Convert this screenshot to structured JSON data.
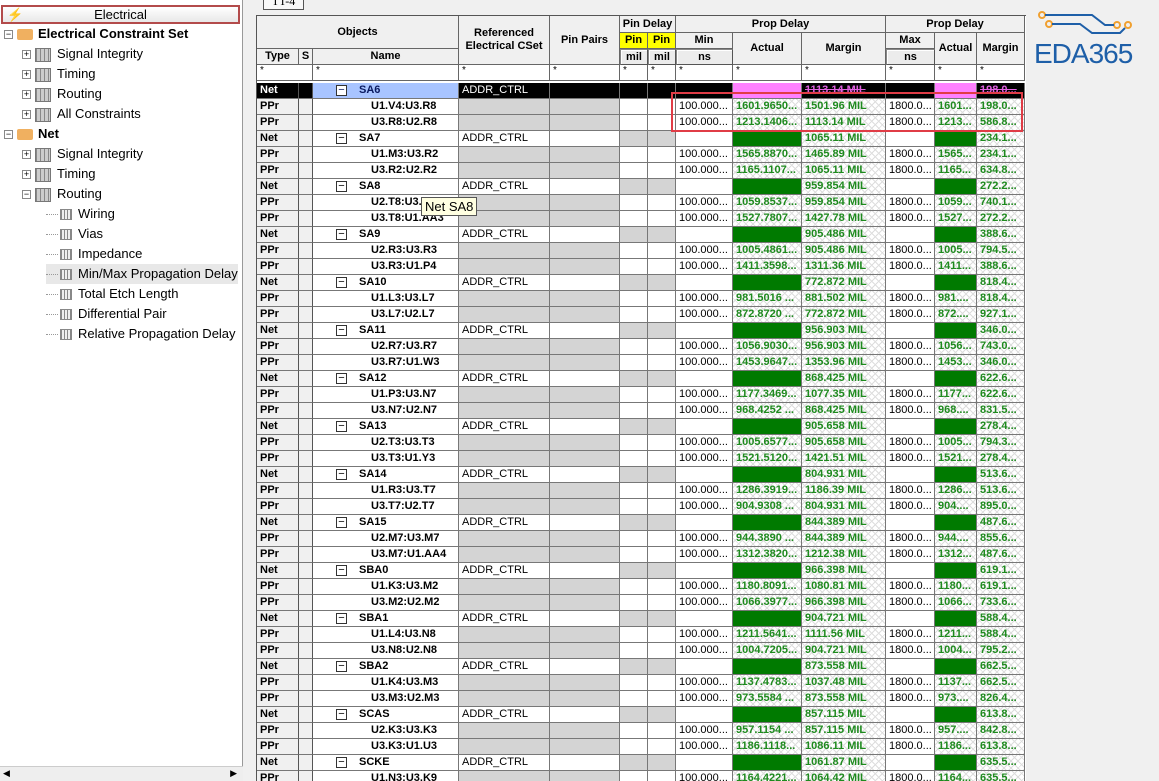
{
  "sidebar": {
    "header": "Electrical",
    "tree": [
      {
        "label": "Electrical Constraint Set",
        "level": 0,
        "kind": "folder"
      },
      {
        "label": "Signal Integrity",
        "level": 1,
        "kind": "group"
      },
      {
        "label": "Timing",
        "level": 1,
        "kind": "group"
      },
      {
        "label": "Routing",
        "level": 1,
        "kind": "group"
      },
      {
        "label": "All Constraints",
        "level": 1,
        "kind": "group"
      },
      {
        "label": "Net",
        "level": 0,
        "kind": "folder"
      },
      {
        "label": "Signal Integrity",
        "level": 1,
        "kind": "group"
      },
      {
        "label": "Timing",
        "level": 1,
        "kind": "group"
      },
      {
        "label": "Routing",
        "level": 1,
        "kind": "group"
      },
      {
        "label": "Wiring",
        "level": 2,
        "kind": "leaf"
      },
      {
        "label": "Vias",
        "level": 2,
        "kind": "leaf"
      },
      {
        "label": "Impedance",
        "level": 2,
        "kind": "leaf"
      },
      {
        "label": "Min/Max Propagation Delay",
        "level": 2,
        "kind": "leaf",
        "selected": true
      },
      {
        "label": "Total Etch Length",
        "level": 2,
        "kind": "leaf"
      },
      {
        "label": "Differential Pair",
        "level": 2,
        "kind": "leaf"
      },
      {
        "label": "Relative Propagation Delay",
        "level": 2,
        "kind": "leaf"
      }
    ]
  },
  "tab": "TT-4",
  "logo": "EDA365",
  "tooltip": "Net SA8",
  "headers": {
    "objects": "Objects",
    "type": "Type",
    "s": "S",
    "name": "Name",
    "cset": "Referenced Electrical CSet",
    "pinpairs": "Pin Pairs",
    "pindelay": "Pin Delay",
    "pin1": "Pin",
    "pin2": "Pin",
    "mil1": "mil",
    "mil2": "mil",
    "propdelay1": "Prop Delay",
    "min": "Min",
    "ns1": "ns",
    "actual1": "Actual",
    "margin1": "Margin",
    "propdelay2": "Prop Delay",
    "max": "Max",
    "ns2": "ns",
    "actual2": "Actual",
    "margin2": "Margin",
    "filter": "*"
  },
  "colors": {
    "pass": "#1e8a1e",
    "fill": "#007a00",
    "selected_fail": "#ff80ff",
    "highlight_box": "#e03c46"
  },
  "nets": [
    {
      "type": "Net",
      "name": "SA6",
      "cset": "ADDR_CTRL",
      "margin": "1113.14 MIL",
      "margin2": "198.0...",
      "selected": true,
      "pp": [
        [
          "PPr",
          "U1.V4:U3.R8",
          "100.000...",
          "1601.9650...",
          "1501.96 MIL",
          "1800.0...",
          "1601...",
          "198.0..."
        ],
        [
          "PPr",
          "U3.R8:U2.R8",
          "100.000...",
          "1213.1406...",
          "1113.14 MIL",
          "1800.0...",
          "1213...",
          "586.8..."
        ]
      ]
    },
    {
      "type": "Net",
      "name": "SA7",
      "cset": "ADDR_CTRL",
      "margin": "1065.11 MIL",
      "margin2": "234.1...",
      "pp": [
        [
          "PPr",
          "U1.M3:U3.R2",
          "100.000...",
          "1565.8870...",
          "1465.89 MIL",
          "1800.0...",
          "1565...",
          "234.1..."
        ],
        [
          "PPr",
          "U3.R2:U2.R2",
          "100.000...",
          "1165.1107...",
          "1065.11 MIL",
          "1800.0...",
          "1165...",
          "634.8..."
        ]
      ]
    },
    {
      "type": "Net",
      "name": "SA8",
      "cset": "ADDR_CTRL",
      "margin": "959.854 MIL",
      "margin2": "272.2...",
      "pp": [
        [
          "PPr",
          "U2.T8:U3.T8",
          "100.000...",
          "1059.8537...",
          "959.854 MIL",
          "1800.0...",
          "1059...",
          "740.1..."
        ],
        [
          "PPr",
          "U3.T8:U1.AA3",
          "100.000...",
          "1527.7807...",
          "1427.78 MIL",
          "1800.0...",
          "1527...",
          "272.2..."
        ]
      ]
    },
    {
      "type": "Net",
      "name": "SA9",
      "cset": "ADDR_CTRL",
      "margin": "905.486 MIL",
      "margin2": "388.6...",
      "pp": [
        [
          "PPr",
          "U2.R3:U3.R3",
          "100.000...",
          "1005.4861...",
          "905.486 MIL",
          "1800.0...",
          "1005...",
          "794.5..."
        ],
        [
          "PPr",
          "U3.R3:U1.P4",
          "100.000...",
          "1411.3598...",
          "1311.36 MIL",
          "1800.0...",
          "1411...",
          "388.6..."
        ]
      ]
    },
    {
      "type": "Net",
      "name": "SA10",
      "cset": "ADDR_CTRL",
      "margin": "772.872 MIL",
      "margin2": "818.4...",
      "pp": [
        [
          "PPr",
          "U1.L3:U3.L7",
          "100.000...",
          "981.5016 ...",
          "881.502 MIL",
          "1800.0...",
          "981....",
          "818.4..."
        ],
        [
          "PPr",
          "U3.L7:U2.L7",
          "100.000...",
          "872.8720 ...",
          "772.872 MIL",
          "1800.0...",
          "872....",
          "927.1..."
        ]
      ]
    },
    {
      "type": "Net",
      "name": "SA11",
      "cset": "ADDR_CTRL",
      "margin": "956.903 MIL",
      "margin2": "346.0...",
      "pp": [
        [
          "PPr",
          "U2.R7:U3.R7",
          "100.000...",
          "1056.9030...",
          "956.903 MIL",
          "1800.0...",
          "1056...",
          "743.0..."
        ],
        [
          "PPr",
          "U3.R7:U1.W3",
          "100.000...",
          "1453.9647...",
          "1353.96 MIL",
          "1800.0...",
          "1453...",
          "346.0..."
        ]
      ]
    },
    {
      "type": "Net",
      "name": "SA12",
      "cset": "ADDR_CTRL",
      "margin": "868.425 MIL",
      "margin2": "622.6...",
      "pp": [
        [
          "PPr",
          "U1.P3:U3.N7",
          "100.000...",
          "1177.3469...",
          "1077.35 MIL",
          "1800.0...",
          "1177...",
          "622.6..."
        ],
        [
          "PPr",
          "U3.N7:U2.N7",
          "100.000...",
          "968.4252 ...",
          "868.425 MIL",
          "1800.0...",
          "968....",
          "831.5..."
        ]
      ]
    },
    {
      "type": "Net",
      "name": "SA13",
      "cset": "ADDR_CTRL",
      "margin": "905.658 MIL",
      "margin2": "278.4...",
      "pp": [
        [
          "PPr",
          "U2.T3:U3.T3",
          "100.000...",
          "1005.6577...",
          "905.658 MIL",
          "1800.0...",
          "1005...",
          "794.3..."
        ],
        [
          "PPr",
          "U3.T3:U1.Y3",
          "100.000...",
          "1521.5120...",
          "1421.51 MIL",
          "1800.0...",
          "1521...",
          "278.4..."
        ]
      ]
    },
    {
      "type": "Net",
      "name": "SA14",
      "cset": "ADDR_CTRL",
      "margin": "804.931 MIL",
      "margin2": "513.6...",
      "pp": [
        [
          "PPr",
          "U1.R3:U3.T7",
          "100.000...",
          "1286.3919...",
          "1186.39 MIL",
          "1800.0...",
          "1286...",
          "513.6..."
        ],
        [
          "PPr",
          "U3.T7:U2.T7",
          "100.000...",
          "904.9308 ...",
          "804.931 MIL",
          "1800.0...",
          "904....",
          "895.0..."
        ]
      ]
    },
    {
      "type": "Net",
      "name": "SA15",
      "cset": "ADDR_CTRL",
      "margin": "844.389 MIL",
      "margin2": "487.6...",
      "pp": [
        [
          "PPr",
          "U2.M7:U3.M7",
          "100.000...",
          "944.3890 ...",
          "844.389 MIL",
          "1800.0...",
          "944....",
          "855.6..."
        ],
        [
          "PPr",
          "U3.M7:U1.AA4",
          "100.000...",
          "1312.3820...",
          "1212.38 MIL",
          "1800.0...",
          "1312...",
          "487.6..."
        ]
      ]
    },
    {
      "type": "Net",
      "name": "SBA0",
      "cset": "ADDR_CTRL",
      "margin": "966.398 MIL",
      "margin2": "619.1...",
      "pp": [
        [
          "PPr",
          "U1.K3:U3.M2",
          "100.000...",
          "1180.8091...",
          "1080.81 MIL",
          "1800.0...",
          "1180...",
          "619.1..."
        ],
        [
          "PPr",
          "U3.M2:U2.M2",
          "100.000...",
          "1066.3977...",
          "966.398 MIL",
          "1800.0...",
          "1066...",
          "733.6..."
        ]
      ]
    },
    {
      "type": "Net",
      "name": "SBA1",
      "cset": "ADDR_CTRL",
      "margin": "904.721 MIL",
      "margin2": "588.4...",
      "pp": [
        [
          "PPr",
          "U1.L4:U3.N8",
          "100.000...",
          "1211.5641...",
          "1111.56 MIL",
          "1800.0...",
          "1211...",
          "588.4..."
        ],
        [
          "PPr",
          "U3.N8:U2.N8",
          "100.000...",
          "1004.7205...",
          "904.721 MIL",
          "1800.0...",
          "1004...",
          "795.2..."
        ]
      ]
    },
    {
      "type": "Net",
      "name": "SBA2",
      "cset": "ADDR_CTRL",
      "margin": "873.558 MIL",
      "margin2": "662.5...",
      "pp": [
        [
          "PPr",
          "U1.K4:U3.M3",
          "100.000...",
          "1137.4783...",
          "1037.48 MIL",
          "1800.0...",
          "1137...",
          "662.5..."
        ],
        [
          "PPr",
          "U3.M3:U2.M3",
          "100.000...",
          "973.5584 ...",
          "873.558 MIL",
          "1800.0...",
          "973....",
          "826.4..."
        ]
      ]
    },
    {
      "type": "Net",
      "name": "SCAS",
      "cset": "ADDR_CTRL",
      "margin": "857.115 MIL",
      "margin2": "613.8...",
      "pp": [
        [
          "PPr",
          "U2.K3:U3.K3",
          "100.000...",
          "957.1154 ...",
          "857.115 MIL",
          "1800.0...",
          "957....",
          "842.8..."
        ],
        [
          "PPr",
          "U3.K3:U1.U3",
          "100.000...",
          "1186.1118...",
          "1086.11 MIL",
          "1800.0...",
          "1186...",
          "613.8..."
        ]
      ]
    },
    {
      "type": "Net",
      "name": "SCKE",
      "cset": "ADDR_CTRL",
      "margin": "1061.87 MIL",
      "margin2": "635.5...",
      "pp": [
        [
          "PPr",
          "U1.N3:U3.K9",
          "100.000...",
          "1164.4221...",
          "1064.42 MIL",
          "1800.0...",
          "1164...",
          "635.5..."
        ]
      ]
    }
  ]
}
